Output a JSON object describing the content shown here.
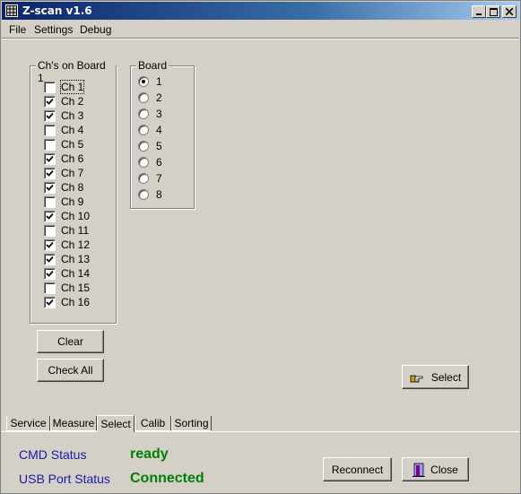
{
  "window": {
    "title": "Z-scan v1.6"
  },
  "menu": [
    "File",
    "Settings",
    "Debug"
  ],
  "channels_group": {
    "title": "Ch's on Board 1",
    "channels": [
      {
        "label": "Ch 1",
        "checked": false
      },
      {
        "label": "Ch 2",
        "checked": true
      },
      {
        "label": "Ch 3",
        "checked": true
      },
      {
        "label": "Ch 4",
        "checked": false
      },
      {
        "label": "Ch 5",
        "checked": false
      },
      {
        "label": "Ch 6",
        "checked": true
      },
      {
        "label": "Ch 7",
        "checked": true
      },
      {
        "label": "Ch 8",
        "checked": true
      },
      {
        "label": "Ch 9",
        "checked": false
      },
      {
        "label": "Ch 10",
        "checked": true
      },
      {
        "label": "Ch 11",
        "checked": false
      },
      {
        "label": "Ch 12",
        "checked": true
      },
      {
        "label": "Ch 13",
        "checked": true
      },
      {
        "label": "Ch 14",
        "checked": true
      },
      {
        "label": "Ch 15",
        "checked": false
      },
      {
        "label": "Ch 16",
        "checked": true
      }
    ]
  },
  "board_group": {
    "title": "Board",
    "boards": [
      "1",
      "2",
      "3",
      "4",
      "5",
      "6",
      "7",
      "8"
    ],
    "selected": "1"
  },
  "buttons": {
    "clear": "Clear",
    "check_all": "Check All",
    "select": "Select",
    "reconnect": "Reconnect",
    "close": "Close"
  },
  "tabs": [
    {
      "label": "Service",
      "active": false
    },
    {
      "label": "Measure",
      "active": false
    },
    {
      "label": "Select",
      "active": true
    },
    {
      "label": "Calib",
      "active": false
    },
    {
      "label": "Sorting",
      "active": false
    }
  ],
  "status": {
    "cmd_label": "CMD Status",
    "cmd_value": "ready",
    "usb_label": "USB Port Status",
    "usb_value": "Connected"
  },
  "colors": {
    "status_label": "#1a1aa6",
    "status_value": "#008000"
  }
}
